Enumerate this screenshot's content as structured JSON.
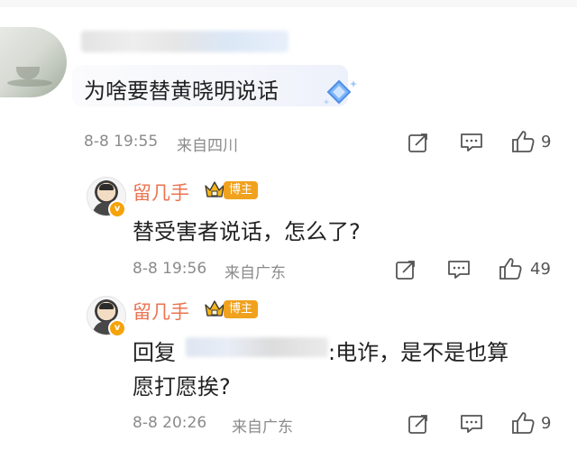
{
  "main_comment": {
    "text": "为啥要替黄晓明说话",
    "time": "8-8 19:55",
    "location": "来自四川",
    "likes": "9"
  },
  "replies": [
    {
      "username": "留几手",
      "badge": "博主",
      "text": "替受害者说话，怎么了?",
      "time": "8-8 19:56",
      "location": "来自广东",
      "likes": "49"
    },
    {
      "username": "留几手",
      "badge": "博主",
      "reply_prefix": "回复",
      "text_line1": ":电诈，是不是也算",
      "text_line2": "愿打愿挨?",
      "time": "8-8 20:26",
      "location": "来自广东",
      "likes": "9"
    }
  ],
  "icons": [
    "share-icon",
    "comment-icon",
    "thumbs-up-icon",
    "crown-icon",
    "diamond-icon",
    "verified-icon"
  ],
  "colors": {
    "username": "#eb7350",
    "badge": "#f0a11d",
    "meta": "#8b8b8b",
    "diamond": "#6fa8f5"
  }
}
